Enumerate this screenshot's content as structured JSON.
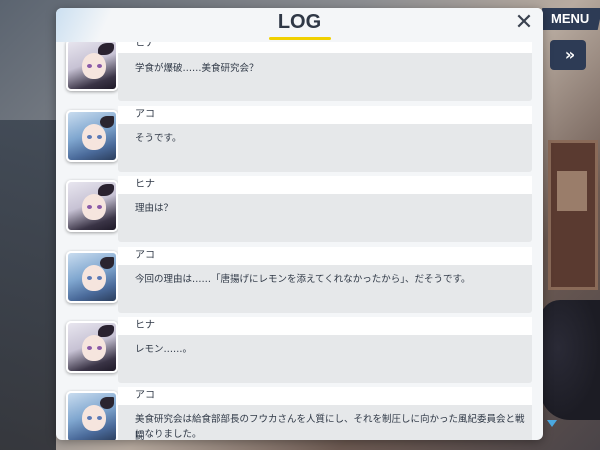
{
  "window": {
    "title": "LOG"
  },
  "top_menu": {
    "label": "MENU"
  },
  "fast_forward": {
    "glyph": "»"
  },
  "close": {
    "glyph": "✕"
  },
  "entries": [
    {
      "speaker": "ヒナ",
      "character": "hina",
      "lines": [
        "学食が爆破……美食研究会？"
      ]
    },
    {
      "speaker": "アコ",
      "character": "ako",
      "lines": [
        "そうです。"
      ]
    },
    {
      "speaker": "ヒナ",
      "character": "hina",
      "lines": [
        "理由は？"
      ]
    },
    {
      "speaker": "アコ",
      "character": "ako",
      "lines": [
        "今回の理由は……「唐揚げにレモンを添えてくれなかったから」、だそうです。"
      ]
    },
    {
      "speaker": "ヒナ",
      "character": "hina",
      "lines": [
        "レモン……。"
      ]
    },
    {
      "speaker": "アコ",
      "character": "ako",
      "lines": [
        "美食研究会は給食部部長のフウカさんを人質にし、それを制圧しに向かった風紀委員会と戦闘",
        "になりました。"
      ]
    }
  ]
}
